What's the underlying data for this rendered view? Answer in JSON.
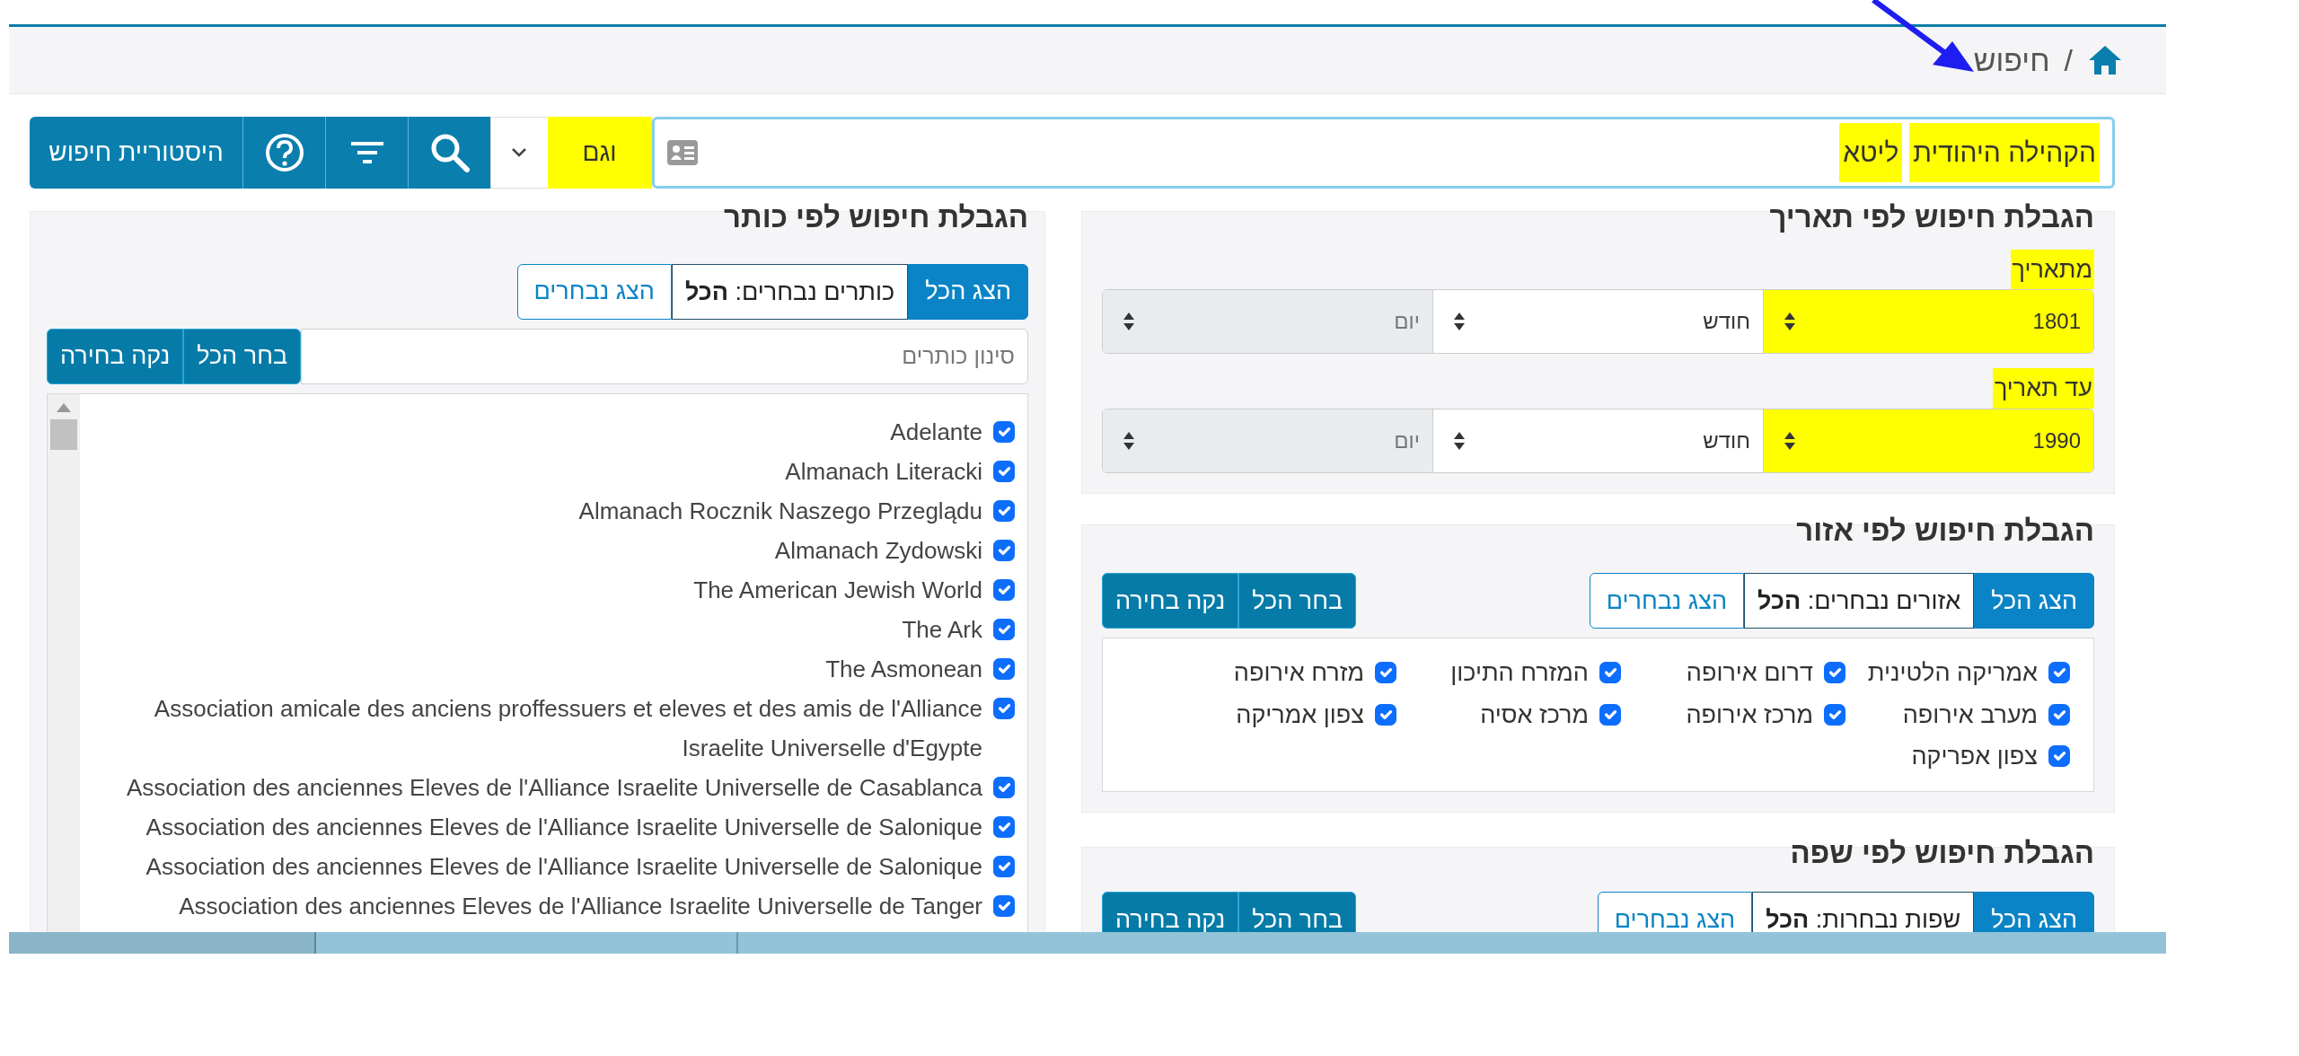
{
  "breadcrumb": {
    "separator": "/",
    "current": "חיפוש"
  },
  "search_bar": {
    "terms": [
      {
        "text": "הקהילה היהודית",
        "highlighted": true
      },
      {
        "text": "ליטא",
        "highlighted": true
      }
    ],
    "operator": {
      "value": "וגם",
      "highlighted": true
    },
    "history_button": "היסטוריית חיפוש"
  },
  "date_filter": {
    "title": "הגבלת חיפוש לפי תאריך",
    "ranges": [
      {
        "label": "מתאריך",
        "highlighted": true,
        "year": "1801",
        "month": "חודש",
        "day": "יום",
        "day_disabled": true
      },
      {
        "label": "עד תאריך",
        "highlighted": true,
        "year": "1990",
        "month": "חודש",
        "day": "יום",
        "day_disabled": true
      }
    ]
  },
  "region_filter": {
    "title": "הגבלת חיפוש לפי אזור",
    "view_toggle": [
      {
        "label": "הצג הכל",
        "selected": true
      },
      {
        "label": "הצג נבחרים",
        "selected": false
      }
    ],
    "summary": "אזורים נבחרים: **הכל**",
    "select_all": "בחר הכל",
    "clear": "נקה בחירה",
    "regions": [
      {
        "label": "אמריקה הלטינית",
        "checked": true
      },
      {
        "label": "דרום אירופה",
        "checked": true
      },
      {
        "label": "המזרח התיכון",
        "checked": true
      },
      {
        "label": "מזרח אירופה",
        "checked": true
      },
      {
        "label": "מערב אירופה",
        "checked": true
      },
      {
        "label": "מרכז אירופה",
        "checked": true
      },
      {
        "label": "מרכז אסיה",
        "checked": true
      },
      {
        "label": "צפון אמריקה",
        "checked": true
      },
      {
        "label": "צפון אפריקה",
        "checked": true
      }
    ]
  },
  "language_filter": {
    "title": "הגבלת חיפוש לפי שפה",
    "view_toggle": [
      {
        "label": "הצג הכל",
        "selected": true
      },
      {
        "label": "הצג נבחרים",
        "selected": false
      }
    ],
    "summary": "שפות נבחרות: **הכל**",
    "select_all": "בחר הכל",
    "clear": "נקה בחירה"
  },
  "title_filter": {
    "title": "הגבלת חיפוש לפי כותר",
    "view_toggle": [
      {
        "label": "הצג הכל",
        "selected": true
      },
      {
        "label": "הצג נבחרים",
        "selected": false
      }
    ],
    "summary": "כותרים נבחרים: **הכל**",
    "filter_placeholder": "סינון כותרים",
    "select_all": "בחר הכל",
    "clear": "נקה בחירה",
    "titles": [
      {
        "label": "Adelante",
        "checked": true
      },
      {
        "label": "Almanach Literacki",
        "checked": true
      },
      {
        "label": "Almanach Rocznik Naszego Przeglądu",
        "checked": true
      },
      {
        "label": "Almanach Zydowski",
        "checked": true
      },
      {
        "label": "The American Jewish World",
        "checked": true
      },
      {
        "label": "The Ark",
        "checked": true
      },
      {
        "label": "The Asmonean",
        "checked": true
      },
      {
        "label": "Association amicale des anciens proffessuers et eleves et des amis de l'Alliance Israelite Universelle d'Egypte",
        "checked": true
      },
      {
        "label": "Association des anciennes Eleves de l'Alliance Israelite Universelle de Casablanca",
        "checked": true
      },
      {
        "label": "Association des anciennes Eleves de l'Alliance Israelite Universelle de Salonique",
        "checked": true
      },
      {
        "label": "Association des anciennes Eleves de l'Alliance Israelite Universelle de Salonique",
        "checked": true
      },
      {
        "label": "Association des anciennes Eleves de l'Alliance Israelite Universelle de Tanger",
        "checked": true
      }
    ]
  }
}
